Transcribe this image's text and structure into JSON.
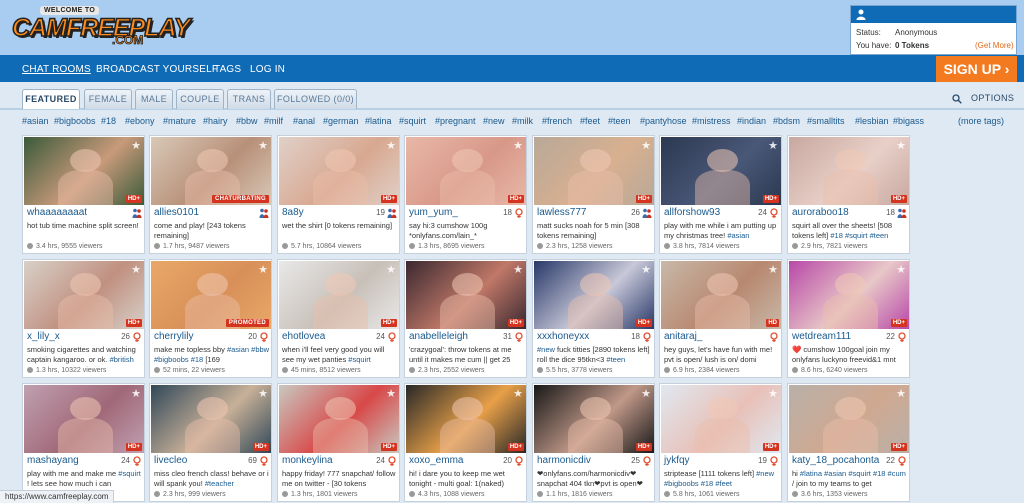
{
  "site": {
    "logo_top": "WELCOME TO",
    "logo_main": "CAMFREEPLAY",
    "logo_tld": ".COM"
  },
  "user": {
    "status_label": "Status:",
    "status_value": "Anonymous",
    "have_label": "You have:",
    "tokens_value": "0 Tokens",
    "get_more": "(Get More)"
  },
  "nav": {
    "chat_rooms": "CHAT ROOMS",
    "broadcast": "BROADCAST YOURSELF",
    "tags": "TAGS",
    "login": "LOG IN",
    "signup": "SIGN UP ›"
  },
  "tabs": [
    "FEATURED",
    "FEMALE",
    "MALE",
    "COUPLE",
    "TRANS",
    "FOLLOWED (0/0)"
  ],
  "options_label": "OPTIONS",
  "hashtags": [
    "#asian",
    "#bigboobs",
    "#18",
    "#ebony",
    "#mature",
    "#hairy",
    "#bbw",
    "#milf",
    "#anal",
    "#german",
    "#latina",
    "#squirt",
    "#pregnant",
    "#new",
    "#milk",
    "#french",
    "#feet",
    "#teen",
    "#pantyhose",
    "#mistress",
    "#indian",
    "#bdsm",
    "#smalltits",
    "#lesbian",
    "#bigass"
  ],
  "more_tags": "(more tags)",
  "colors": {
    "header_bg": "#a8cdf0",
    "nav_bg": "#0f6bb5",
    "signup_bg": "#f47a1f",
    "link": "#1a5a8e",
    "badge_red": "#d4341f"
  },
  "cards": [
    {
      "name": "whaaaaaaaat",
      "age": "",
      "gender": "couple",
      "badge": "HD+",
      "subject": "hot tub time machine split screen!",
      "meta": "3.4 hrs, 9555 viewers",
      "thumb": [
        "#3a5a3a",
        "#c89a7a"
      ]
    },
    {
      "name": "allies0101",
      "age": "",
      "gender": "couple",
      "badge": "CHATURBATING",
      "subject": "come and play! [243 tokens remaining]",
      "meta": "1.7 hrs, 9487 viewers",
      "thumb": [
        "#d8c8b8",
        "#b89078"
      ]
    },
    {
      "name": "8a8y",
      "age": "19",
      "gender": "couple",
      "badge": "HD+",
      "subject": "wet the shirt [0 tokens remaining]",
      "meta": "5.7 hrs, 10864 viewers",
      "thumb": [
        "#e0d0c8",
        "#d8a890"
      ]
    },
    {
      "name": "yum_yum_",
      "age": "18",
      "gender": "female",
      "badge": "HD+",
      "subject": "say hi:3 cumshow 100g *onlyfans.com/lain_*",
      "meta": "1.3 hrs, 8695 viewers",
      "thumb": [
        "#e8b8a8",
        "#d89888"
      ]
    },
    {
      "name": "lawless777",
      "age": "26",
      "gender": "couple",
      "badge": "HD+",
      "subject": "matt sucks noah for 5 min [308 tokens remaining]",
      "meta": "2.3 hrs, 1258 viewers",
      "thumb": [
        "#b8a898",
        "#d8b090"
      ]
    },
    {
      "name": "allforshow93",
      "age": "24",
      "gender": "female",
      "badge": "HD+",
      "subject": "play with me while i am putting up my christmas tree! #asian",
      "meta": "3.8 hrs, 7814 viewers",
      "thumb": [
        "#2a3850",
        "#4a5878"
      ]
    },
    {
      "name": "auroraboo18",
      "age": "18",
      "gender": "couple",
      "badge": "HD+",
      "subject": "squirt all over the sheets! [508 tokens left] #18 #squirt #teen",
      "meta": "2.9 hrs, 7821 viewers",
      "thumb": [
        "#c8a8a0",
        "#e8d0c8"
      ]
    },
    {
      "name": "x_lily_x",
      "age": "26",
      "gender": "female",
      "badge": "HD+",
      "subject": "smoking cigarettes and watching captain kangaroo. or ok. #british",
      "meta": "1.3 hrs, 10322 viewers",
      "thumb": [
        "#d8d0c8",
        "#c09080"
      ]
    },
    {
      "name": "cherrylily",
      "age": "20",
      "gender": "female",
      "badge": "PROMOTED",
      "subject": "make me topless bby #asian #bbw #bigboobs #18 [169",
      "meta": "52 mins, 22 viewers",
      "thumb": [
        "#e8a868",
        "#d89058"
      ]
    },
    {
      "name": "ehotlovea",
      "age": "24",
      "gender": "female",
      "badge": "HD+",
      "subject": "when i'll feel very good you will see my wet panties #squirt",
      "meta": "45 mins, 8512 viewers",
      "thumb": [
        "#e8e8e8",
        "#c8c0b8"
      ]
    },
    {
      "name": "anabelleleigh",
      "age": "31",
      "gender": "female",
      "badge": "HD+",
      "subject": "'crazygoal': throw tokens at me until it makes me cum || get 25",
      "meta": "2.3 hrs, 2552 viewers",
      "thumb": [
        "#3a2830",
        "#c07868"
      ]
    },
    {
      "name": "xxxhoneyxx",
      "age": "18",
      "gender": "female",
      "badge": "HD+",
      "subject": "#new fuck titties [2890 tokens left] roll the dice 95tkn<3 #teen",
      "meta": "5.5 hrs, 3778 viewers",
      "thumb": [
        "#283868",
        "#c8c8d8"
      ]
    },
    {
      "name": "anitaraj_",
      "age": "",
      "gender": "female",
      "badge": "HD",
      "subject": "hey guys, let's have fun with me! pvt is open/ lush is on/ domi",
      "meta": "6.9 hrs, 2384 viewers",
      "thumb": [
        "#c8b8a8",
        "#b88870"
      ]
    },
    {
      "name": "wetdream111",
      "age": "22",
      "gender": "female",
      "badge": "HD+",
      "subject": "❤️ cumshow 100goal join my onlyfans luckyno freevid&1 mnt",
      "meta": "8.6 hrs, 6240 viewers",
      "thumb": [
        "#b848a8",
        "#e8c8c8"
      ]
    },
    {
      "name": "mashayang",
      "age": "24",
      "gender": "female",
      "badge": "HD+",
      "subject": "play with me and make me #squirt ! lets see how much i can",
      "meta": "",
      "thumb": [
        "#c0a0b0",
        "#a06878"
      ]
    },
    {
      "name": "livecleo",
      "age": "69",
      "gender": "female",
      "badge": "HD+",
      "subject": "miss cleo french class! behave or i will spank you! #teacher",
      "meta": "2.3 hrs, 999 viewers",
      "thumb": [
        "#304858",
        "#c8b098"
      ]
    },
    {
      "name": "monkeylina",
      "age": "24",
      "gender": "female",
      "badge": "HD+",
      "subject": "happy friday! 777 snapchat/ follow me on twitter - [30 tokens",
      "meta": "1.3 hrs, 1801 viewers",
      "thumb": [
        "#c8c8c0",
        "#d84848"
      ]
    },
    {
      "name": "xoxo_emma",
      "age": "20",
      "gender": "female",
      "badge": "HD+",
      "subject": "hi! i dare you to keep me wet tonight - multi goal: 1(naked)",
      "meta": "4.3 hrs, 1088 viewers",
      "thumb": [
        "#282828",
        "#e8a048"
      ]
    },
    {
      "name": "harmonicdiv",
      "age": "25",
      "gender": "female",
      "badge": "HD+",
      "subject": "❤onlyfans.com/harmonicdiv❤ snapchat 404 tkn❤pvt is open❤",
      "meta": "1.1 hrs, 1816 viewers",
      "thumb": [
        "#181818",
        "#c09888"
      ]
    },
    {
      "name": "jykfqy",
      "age": "19",
      "gender": "female",
      "badge": "HD+",
      "subject": "striptease [1111 tokens left] #new #bigboobs #18 #feet",
      "meta": "5.8 hrs, 1061 viewers",
      "thumb": [
        "#e0e8f0",
        "#e8c0b8"
      ]
    },
    {
      "name": "katy_18_pocahonta",
      "age": "22",
      "gender": "female",
      "badge": "HD+",
      "subject": "hi #latina #asian #squirt #18 #cum / join to my teams to get",
      "meta": "3.6 hrs, 1353 viewers",
      "thumb": [
        "#b8b0a8",
        "#d0a890"
      ]
    }
  ],
  "status_url": "https://www.camfreeplay.com"
}
